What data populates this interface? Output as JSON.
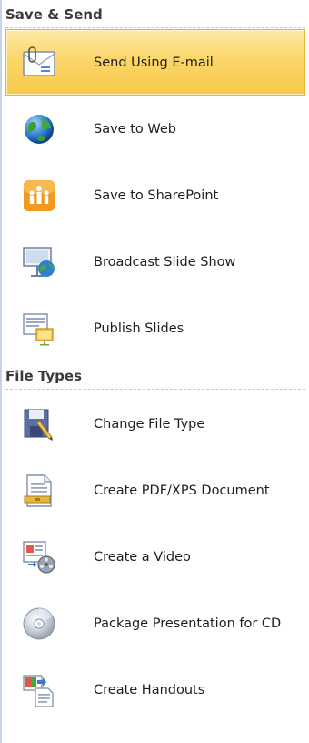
{
  "save_send": {
    "header": "Save & Send",
    "items": [
      {
        "label": "Send Using E-mail",
        "icon": "email-icon",
        "selected": true
      },
      {
        "label": "Save to Web",
        "icon": "globe-icon"
      },
      {
        "label": "Save to SharePoint",
        "icon": "sharepoint-icon"
      },
      {
        "label": "Broadcast Slide Show",
        "icon": "broadcast-icon"
      },
      {
        "label": "Publish Slides",
        "icon": "publish-slides-icon"
      }
    ]
  },
  "file_types": {
    "header": "File Types",
    "items": [
      {
        "label": "Change File Type",
        "icon": "change-file-type-icon"
      },
      {
        "label": "Create PDF/XPS Document",
        "icon": "pdf-document-icon"
      },
      {
        "label": "Create a Video",
        "icon": "video-icon"
      },
      {
        "label": "Package Presentation for CD",
        "icon": "cd-icon"
      },
      {
        "label": "Create Handouts",
        "icon": "handouts-icon"
      }
    ]
  },
  "colors": {
    "selected_top": "#fde9a6",
    "selected_bottom": "#f8c94a",
    "selected_border": "#e5b53a",
    "sharepoint_orange": "#f39a1e",
    "globe_blue": "#2d7fd3"
  }
}
